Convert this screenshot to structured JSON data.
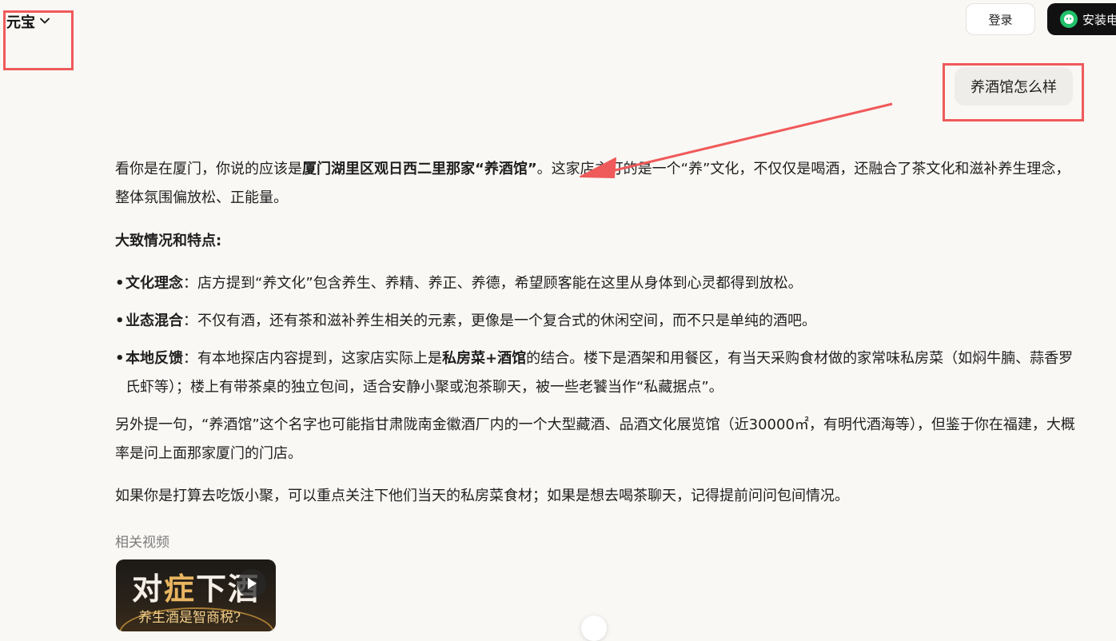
{
  "header": {
    "brand": "元宝",
    "login_label": "登录",
    "install_label": "安装电"
  },
  "chat": {
    "user_message": "养酒馆怎么样"
  },
  "answer": {
    "intro_pre": "看你是在厦门，你说的应该是",
    "intro_bold": "厦门湖里区观日西二里那家“养酒馆”",
    "intro_post": "。这家店主打的是一个“养”文化，不仅仅是喝酒，还融合了茶文化和滋补养生理念，整体氛围偏放松、正能量。",
    "heading": "大致情况和特点:",
    "bullets": [
      {
        "title": "文化理念",
        "text": "：店方提到“养文化”包含养生、养精、养正、养德，希望顾客能在这里从身体到心灵都得到放松。"
      },
      {
        "title": "业态混合",
        "text": "：不仅有酒，还有茶和滋补养生相关的元素，更像是一个复合式的休闲空间，而不只是单纯的酒吧。"
      },
      {
        "title": "本地反馈",
        "text_pre": "：有本地探店内容提到，这家店实际上是",
        "text_bold": "私房菜+酒馆",
        "text_post": "的结合。楼下是酒架和用餐区，有当天采购食材做的家常味私房菜（如焖牛腩、蒜香罗氏虾等）；楼上有带茶桌的独立包间，适合安静小聚或泡茶聊天，被一些老饕当作“私藏据点”。"
      }
    ],
    "note": "另外提一句，“养酒馆”这个名字也可能指甘肃陇南金徽酒厂内的一个大型藏酒、品酒文化展览馆（近30000㎡，有明代酒海等），但鉴于你在福建，大概率是问上面那家厦门的门店。",
    "closing": "如果你是打算去吃饭小聚，可以重点关注下他们当天的私房菜食材；如果是想去喝茶聊天，记得提前问问包间情况。"
  },
  "related": {
    "label": "相关视频",
    "video": {
      "title_a": "对",
      "title_b": "症",
      "title_c": "下酒",
      "subtitle": "养生酒是智商税?"
    }
  },
  "colors": {
    "background": "#faf8f5",
    "annotation": "#ef5a5a",
    "install_icon": "#21c16b"
  }
}
